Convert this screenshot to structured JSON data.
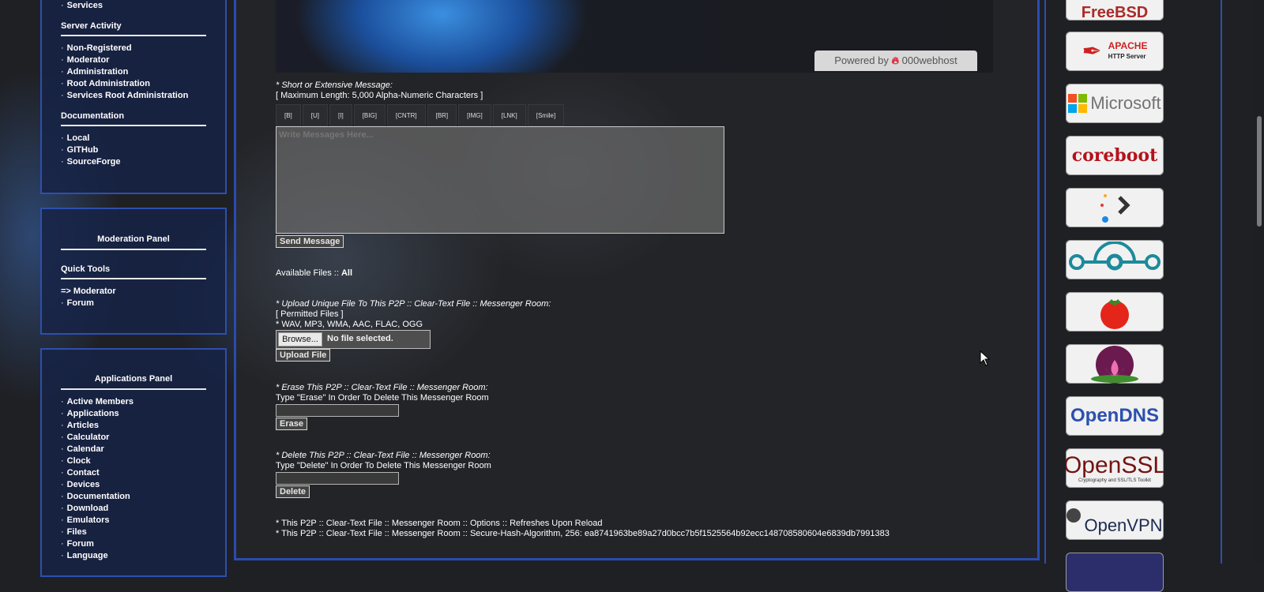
{
  "left_sidebar": {
    "top_partial_item": "Services",
    "server_activity": {
      "heading": "Server Activity",
      "items": [
        "Non-Registered",
        "Moderator",
        "Administration",
        "Root Administration",
        "Services Root Administration"
      ]
    },
    "documentation": {
      "heading": "Documentation",
      "items": [
        "Local",
        "GITHub",
        "SourceForge"
      ]
    },
    "moderation_panel": {
      "title": "Moderation Panel",
      "quick_tools_heading": "Quick Tools",
      "moderator_link": "=> Moderator",
      "items": [
        "Forum"
      ]
    },
    "applications_panel": {
      "title": "Applications Panel",
      "items": [
        "Active Members",
        "Applications",
        "Articles",
        "Calculator",
        "Calendar",
        "Clock",
        "Contact",
        "Devices",
        "Documentation",
        "Download",
        "Emulators",
        "Files",
        "Forum",
        "Language"
      ]
    },
    "bullet": "·"
  },
  "banner": {
    "powered_by": "Powered by",
    "host": "000webhost"
  },
  "message_form": {
    "label": "* Short or Extensive Message:",
    "max_length": "[ Maximum Length: 5,000 Alpha-Numeric Characters ]",
    "format_buttons": [
      "[B]",
      "[U]",
      "[I]",
      "[BIG]",
      "[CNTR]",
      "[BR]",
      "[IMG]",
      "[LNK]",
      "[Smile]"
    ],
    "placeholder": "Write Messages Here...",
    "send_label": "Send Message"
  },
  "files": {
    "available_label": "Available Files ::",
    "available_value": "All"
  },
  "upload": {
    "label": "* Upload Unique File To This P2P :: Clear-Text File :: Messenger Room:",
    "permitted": "[ Permitted Files ]",
    "types": "* WAV, MP3, WMA, AAC, FLAC, OGG",
    "browse_label": "Browse...",
    "no_file": "No file selected.",
    "upload_label": "Upload File"
  },
  "erase": {
    "label": "* Erase This P2P :: Clear-Text File :: Messenger Room:",
    "instruction": "Type \"Erase\" In Order To Delete This Messenger Room",
    "button_label": "Erase"
  },
  "delete": {
    "label": "* Delete This P2P :: Clear-Text File :: Messenger Room:",
    "instruction": "Type \"Delete\" In Order To Delete This Messenger Room",
    "button_label": "Delete"
  },
  "footer_notes": [
    "* This P2P :: Clear-Text File :: Messenger Room :: Options :: Refreshes Upon Reload",
    "* This P2P :: Clear-Text File :: Messenger Room :: Secure-Hash-Algorithm, 256: ea8741963be89a27d0bcc7b5f1525564b92ecc148708580604e6839db7991383"
  ],
  "logos": [
    {
      "name": "FreeBSD",
      "text": "FreeBSD"
    },
    {
      "name": "Apache HTTP Server",
      "text": "APACHE",
      "sub": "HTTP Server"
    },
    {
      "name": "Microsoft",
      "text": "Microsoft"
    },
    {
      "name": "coreboot",
      "text": "coreboot"
    },
    {
      "name": "terminal",
      "text": ""
    },
    {
      "name": "LineageOS",
      "text": ""
    },
    {
      "name": "tomato",
      "text": ""
    },
    {
      "name": "lotus",
      "text": ""
    },
    {
      "name": "OpenDNS",
      "text": "OpenDNS"
    },
    {
      "name": "OpenSSL",
      "text": "OpenSSL",
      "sub": "Cryptography and SSL/TLS Toolkit"
    },
    {
      "name": "OpenVPN",
      "text": "OpenVPN"
    }
  ],
  "colors": {
    "accent_border": "#2d4fae",
    "background": "#1f2024"
  }
}
